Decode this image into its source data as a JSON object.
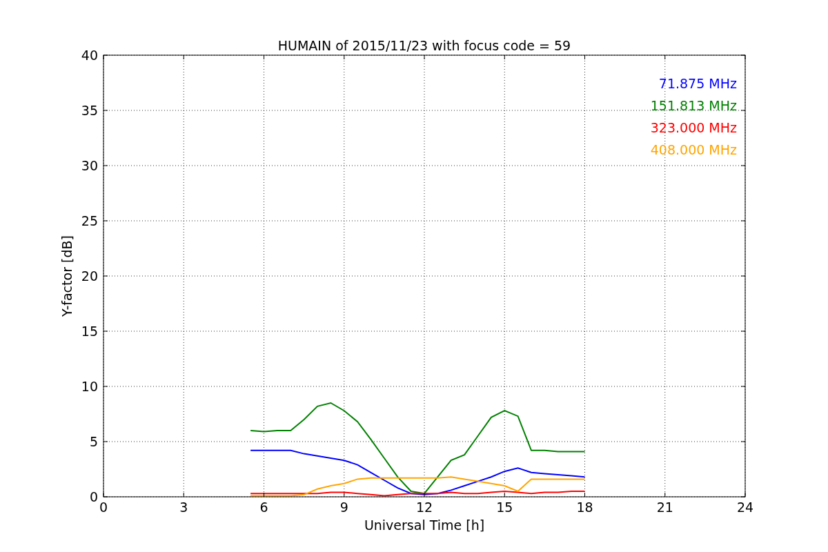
{
  "chart_data": {
    "type": "line",
    "title": "HUMAIN of 2015/11/23 with focus code = 59",
    "xlabel": "Universal Time [h]",
    "ylabel": "Y-factor [dB]",
    "x": [
      5.5,
      6,
      6.5,
      7,
      7.5,
      8,
      8.5,
      9,
      9.5,
      10,
      10.5,
      11,
      11.5,
      12,
      12.5,
      13,
      13.5,
      14,
      14.5,
      15,
      15.5,
      16,
      16.5,
      17,
      17.5,
      18
    ],
    "series": [
      {
        "name": "71.875 MHz",
        "color": "#0000ff",
        "values": [
          4.2,
          4.2,
          4.2,
          4.2,
          3.9,
          3.7,
          3.5,
          3.3,
          2.9,
          2.2,
          1.5,
          0.8,
          0.3,
          0.2,
          0.3,
          0.6,
          1.0,
          1.4,
          1.8,
          2.3,
          2.6,
          2.2,
          2.1,
          2.0,
          1.9,
          1.8
        ]
      },
      {
        "name": "151.813 MHz",
        "color": "#008000",
        "values": [
          6.0,
          5.9,
          6.0,
          6.0,
          7.0,
          8.2,
          8.5,
          7.8,
          6.8,
          5.2,
          3.5,
          1.8,
          0.5,
          0.3,
          1.8,
          3.3,
          3.8,
          5.5,
          7.2,
          7.8,
          7.3,
          4.2,
          4.2,
          4.1,
          4.1,
          4.1
        ]
      },
      {
        "name": "323.000 MHz",
        "color": "#ff0000",
        "values": [
          0.3,
          0.3,
          0.3,
          0.3,
          0.3,
          0.3,
          0.4,
          0.4,
          0.3,
          0.2,
          0.1,
          0.2,
          0.3,
          0.3,
          0.3,
          0.4,
          0.3,
          0.3,
          0.4,
          0.5,
          0.4,
          0.3,
          0.4,
          0.4,
          0.5,
          0.5
        ]
      },
      {
        "name": "408.000 MHz",
        "color": "#ffa500",
        "values": [
          0.1,
          0.1,
          0.1,
          0.1,
          0.2,
          0.7,
          1.0,
          1.2,
          1.6,
          1.7,
          1.7,
          1.7,
          1.7,
          1.7,
          1.7,
          1.8,
          1.6,
          1.4,
          1.2,
          1.0,
          0.5,
          1.6,
          1.6,
          1.6,
          1.6,
          1.6
        ]
      }
    ],
    "grid": true,
    "xlim": [
      0,
      24
    ],
    "ylim": [
      0,
      40
    ],
    "xticks": [
      0,
      3,
      6,
      9,
      12,
      15,
      18,
      21,
      24
    ],
    "yticks": [
      0,
      5,
      10,
      15,
      20,
      25,
      30,
      35,
      40
    ]
  }
}
